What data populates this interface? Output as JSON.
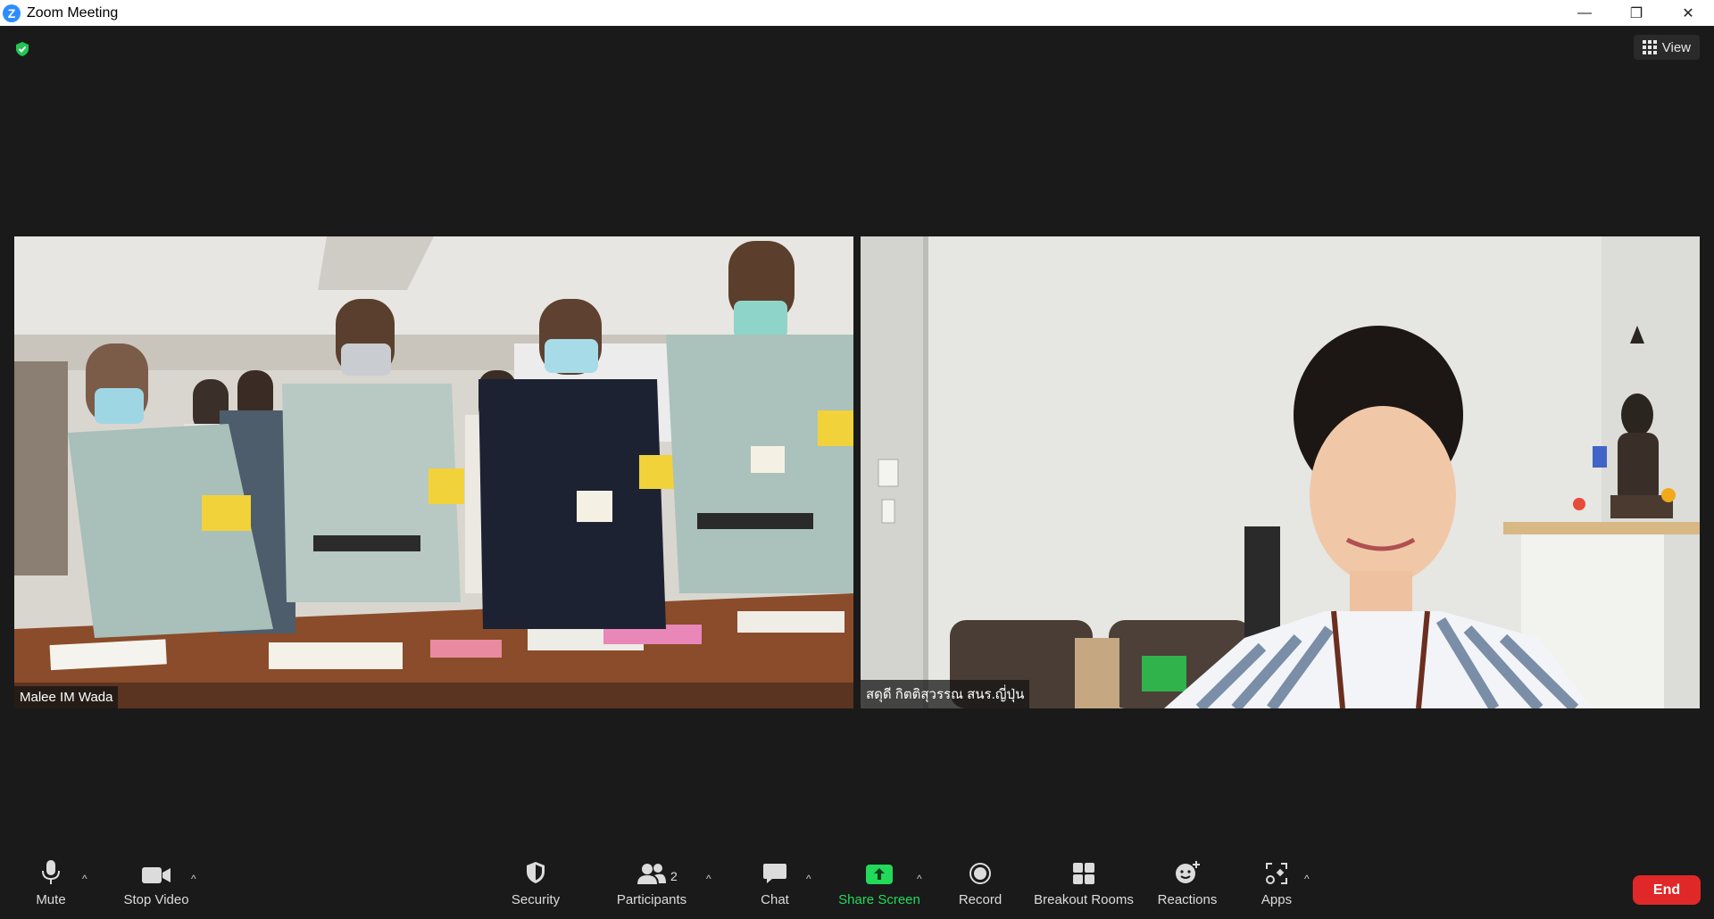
{
  "window": {
    "title": "Zoom Meeting",
    "logo_letter": "Z",
    "minimize": "—",
    "restore": "❐",
    "close": "✕"
  },
  "header": {
    "view_label": "View",
    "encryption_icon": "green-shield-icon"
  },
  "participants": [
    {
      "name": "Malee IM Wada"
    },
    {
      "name": "สดุดี กิตติสุวรรณ สนร.ญี่ปุ่น"
    }
  ],
  "toolbar": {
    "mute": "Mute",
    "stop_video": "Stop Video",
    "security": "Security",
    "participants": "Participants",
    "participants_count": "2",
    "chat": "Chat",
    "share_screen": "Share Screen",
    "record": "Record",
    "breakout_rooms": "Breakout Rooms",
    "reactions": "Reactions",
    "apps": "Apps",
    "end": "End",
    "caret": "^"
  },
  "colors": {
    "accent_green": "#23d959",
    "end_red": "#e02828",
    "zoom_blue": "#2d8cff"
  }
}
